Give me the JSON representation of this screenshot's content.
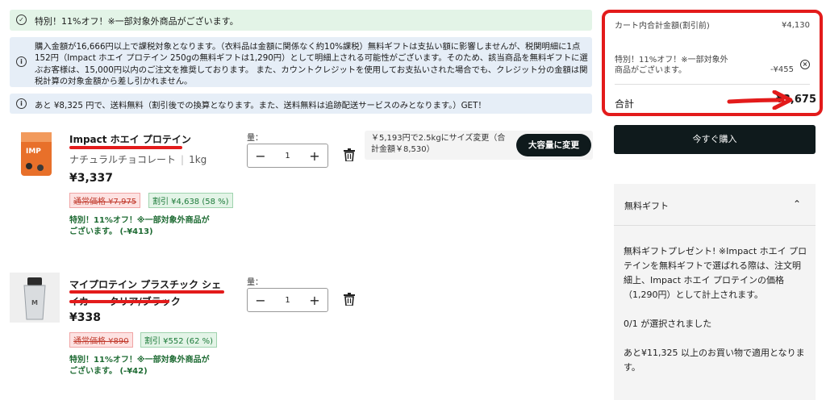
{
  "banners": {
    "promo": "特別！11%オフ！※一部対象外商品がございます。",
    "tax_notice": "購入金額が16,666円以上で課税対象となります。（衣料品は金額に関係なく約10%課税）無料ギフトは支払い額に影響しませんが、税関明細に1点152円（Impact ホエイ プロテイン 250gの無料ギフトは1,290円）として明細上される可能性がございます。そのため、該当商品を無料ギフトに選ぶお客様は、15,000円以内のご注文を推奨しております。 また、カウントクレジットを使用してお支払いされた場合でも、クレジット分の金額は関税計算の対象金額から差し引かれません。",
    "shipping": "あと ¥8,325 円で、送料無料（割引後での換算となります。また、送料無料は追跡配送サービスのみとなります。）GET！"
  },
  "items": [
    {
      "name": "Impact ホエイ プロテイン",
      "flavor": "ナチュラルチョコレート",
      "size": "1kg",
      "price": "¥3,337",
      "original_price": "通常価格 ¥7,975",
      "discount": "割引 ¥4,638 (58 %)",
      "promo": "特別！11%オフ！※一部対象外商品がございます。 (-¥413)",
      "qty_label": "量：",
      "qty": "1",
      "upsell_text": "￥5,193円で2.5kgにサイズ変更（合計金額￥8,530）",
      "upsell_button": "大容量に変更"
    },
    {
      "name": "マイプロテイン プラスチック シェイカー - クリア/ブラック",
      "price": "¥338",
      "original_price": "通常価格 ¥890",
      "discount": "割引 ¥552 (62 %)",
      "promo": "特別！11%オフ！※一部対象外商品がございます。 (-¥42)",
      "qty_label": "量：",
      "qty": "1"
    }
  ],
  "summary": {
    "subtotal_label": "カート内合計金額(割引前)",
    "subtotal_value": "¥4,130",
    "discount_label": "特別！11%オフ！※一部対象外商品がございます。",
    "discount_value": "-¥455",
    "total_label": "合計",
    "total_value": "¥3,675",
    "buy_button": "今すぐ購入"
  },
  "gift": {
    "title": "無料ギフト",
    "description": "無料ギフトプレゼント! ※Impact ホエイ プロテインを無料ギフトで選ばれる際は、注文明細上、Impact ホエイ プロテインの価格（1,290円）として計上されます。",
    "selected": "0/1 が選択されました",
    "remaining": "あと¥11,325 以上のお買い物で適用となります。"
  },
  "colors": {
    "annotation_red": "#e31b1b",
    "dark_button": "#0f1a1c",
    "promo_green": "#1e6b33"
  }
}
